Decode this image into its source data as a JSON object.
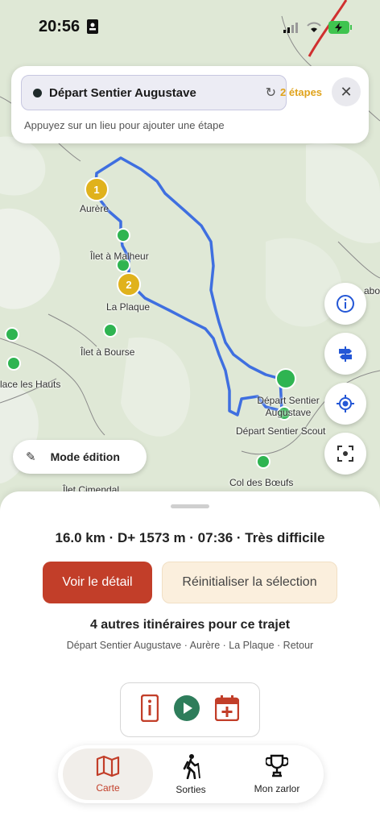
{
  "status_bar": {
    "time": "20:56"
  },
  "search": {
    "value": "Départ Sentier Augustave",
    "steps": "2 étapes",
    "hint": "Appuyez sur un lieu pour ajouter une étape"
  },
  "map": {
    "labels": {
      "aurere": "Aurère",
      "ilet_malheur": "Îlet à Malheur",
      "la_plaque": "La Plaque",
      "ilet_bourse": "Îlet à Bourse",
      "place_hauts": "lace les Hauts",
      "depart_augustave": "Départ Sentier Augustave",
      "depart_scout": "Départ Sentier Scout",
      "col_boeufs": "Col des Bœufs",
      "ilet_cimendal": "Îlet Cimendal",
      "edge_abo": "abo"
    },
    "markers": {
      "step1": "1",
      "step2": "2"
    }
  },
  "mode_edit": {
    "label": "Mode édition"
  },
  "sheet": {
    "summary": "16.0 km · D+ 1573 m · 07:36 · Très difficile",
    "detail_button": "Voir le détail",
    "reset_button": "Réinitialiser la sélection",
    "alternatives_title": "4 autres itinéraires pour ce trajet",
    "alternatives_sub": "Départ Sentier Augustave · Aurère · La Plaque · Retour"
  },
  "tabs": [
    {
      "label": "Carte",
      "icon": "map-icon",
      "active": true
    },
    {
      "label": "Sorties",
      "icon": "hiker-icon",
      "active": false
    },
    {
      "label": "Mon zarlor",
      "icon": "trophy-icon",
      "active": false
    }
  ],
  "colors": {
    "accent": "#c23e29",
    "route": "#3f6fe0",
    "marker_green": "#2fb451",
    "marker_yellow": "#e0b21c",
    "steps": "#e0a31c"
  }
}
